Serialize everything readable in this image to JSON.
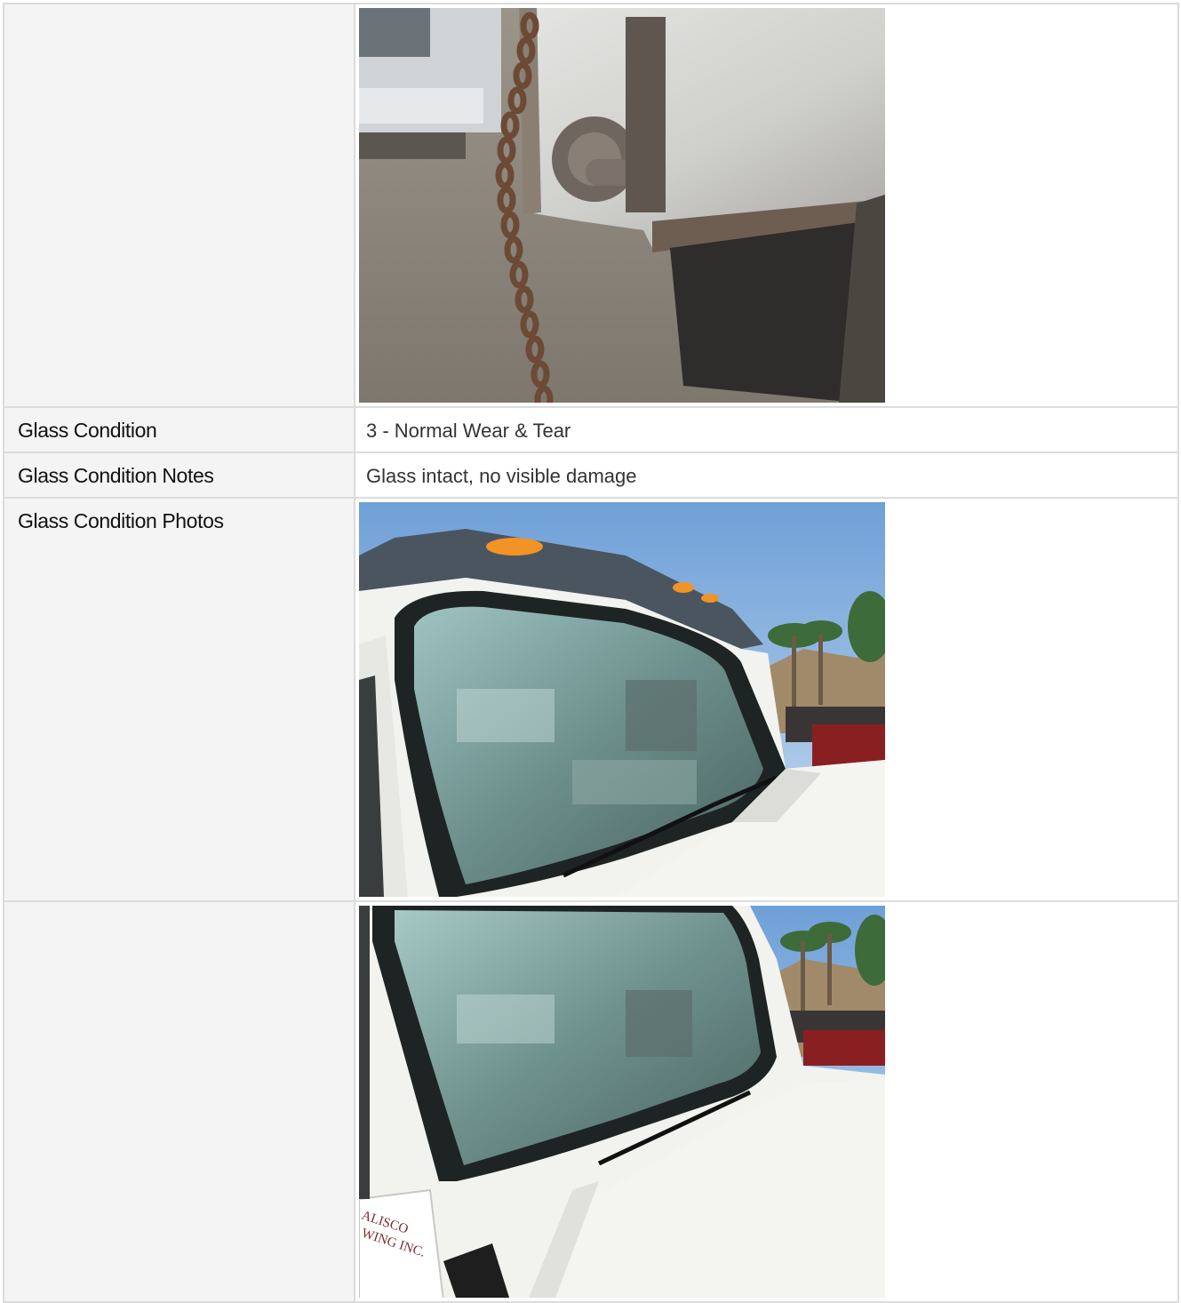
{
  "rows": [
    {
      "label": "",
      "type": "photo",
      "photo": "tailgate-chain-photo"
    },
    {
      "label": "Glass Condition",
      "type": "text",
      "value": "3 - Normal Wear & Tear"
    },
    {
      "label": "Glass Condition Notes",
      "type": "text",
      "value": "Glass intact, no visible damage"
    },
    {
      "label": "Glass Condition Photos",
      "type": "photo",
      "photo": "windshield-photo-1"
    },
    {
      "label": "",
      "type": "photo",
      "photo": "windshield-photo-2"
    }
  ],
  "photo2_door_text": [
    "ALISCO",
    "WING INC."
  ],
  "colors": {
    "label_bg": "#f4f4f4",
    "border": "#dcdcdc"
  }
}
